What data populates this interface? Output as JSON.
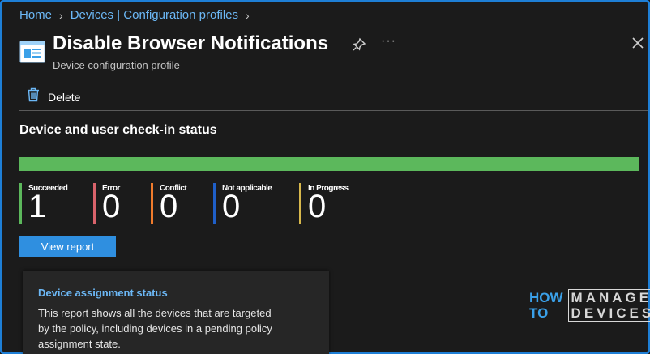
{
  "breadcrumb": {
    "items": [
      "Home",
      "Devices | Configuration profiles"
    ]
  },
  "header": {
    "title": "Disable Browser Notifications",
    "subtitle": "Device configuration profile",
    "more_label": "···"
  },
  "toolbar": {
    "delete_label": "Delete"
  },
  "status": {
    "section_title": "Device and user check-in status",
    "bar_fraction_succeeded": 1.0,
    "items": [
      {
        "label": "Succeeded",
        "value": "1",
        "color": "#5cb85c"
      },
      {
        "label": "Error",
        "value": "0",
        "color": "#d9636b"
      },
      {
        "label": "Conflict",
        "value": "0",
        "color": "#f07b2c"
      },
      {
        "label": "Not applicable",
        "value": "0",
        "color": "#1f5fc8"
      },
      {
        "label": "In Progress",
        "value": "0",
        "color": "#d8b84c"
      }
    ],
    "view_report_label": "View report"
  },
  "card": {
    "title": "Device assignment status",
    "description": "This report shows all the devices that are targeted by the policy, including devices in a pending policy assignment state."
  },
  "watermark": {
    "left_lines": [
      "HOW",
      "TO"
    ],
    "right_lines": [
      "MANAGE",
      "DEVICES"
    ]
  },
  "colors": {
    "accent": "#2f8fe0",
    "link": "#6cb8f6",
    "background": "#1b1b1b",
    "success": "#5cb85c"
  }
}
